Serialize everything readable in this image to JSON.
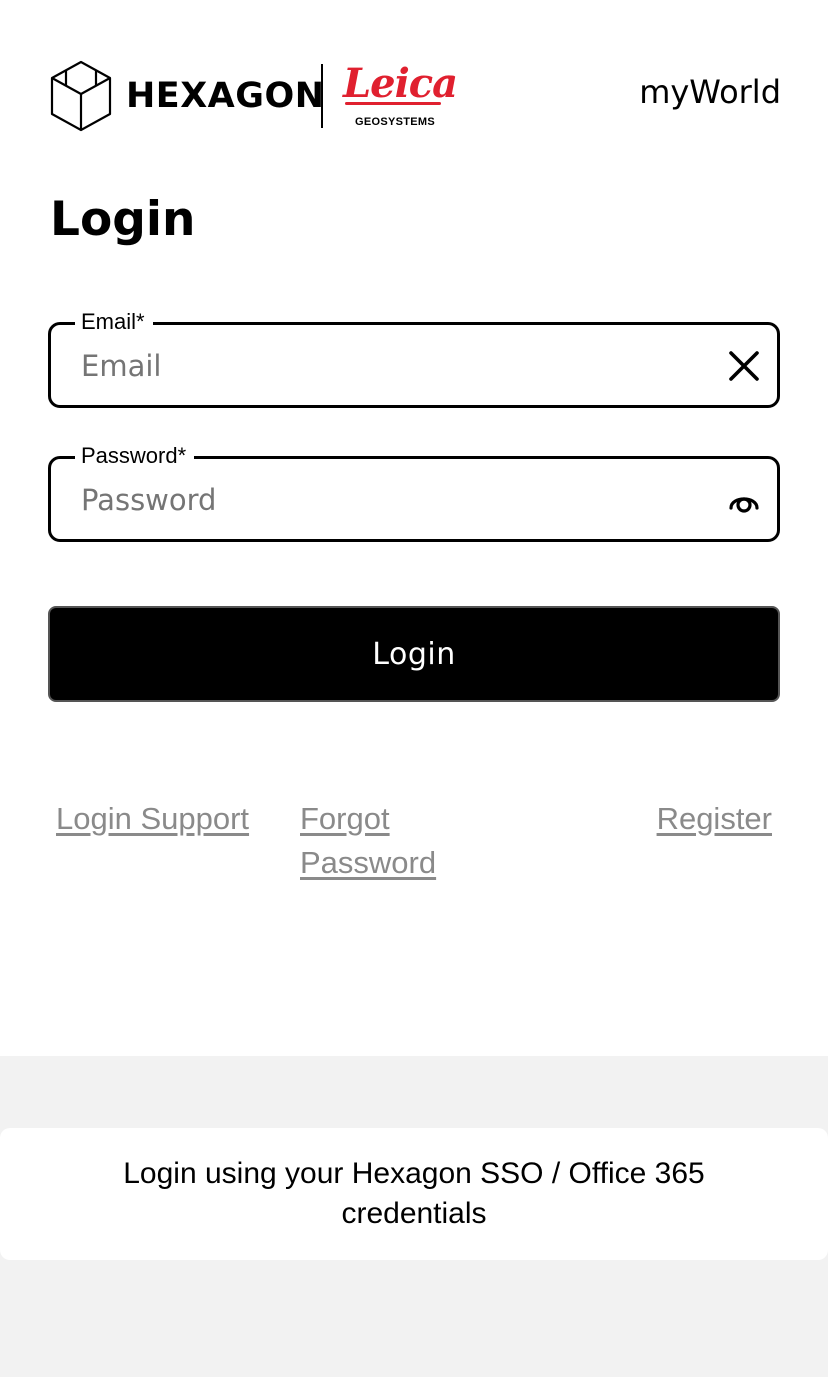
{
  "header": {
    "brand_name": "HEXAGON",
    "partner_name": "Leica",
    "partner_subtitle": "GEOSYSTEMS",
    "app_name_prefix": "my",
    "app_name_suffix": "World"
  },
  "page": {
    "title": "Login"
  },
  "form": {
    "email": {
      "label": "Email*",
      "placeholder": "Email",
      "value": "",
      "icon": "close-icon"
    },
    "password": {
      "label": "Password*",
      "placeholder": "Password",
      "value": "",
      "icon": "eye-icon"
    },
    "submit_label": "Login"
  },
  "links": {
    "login_support": "Login Support",
    "forgot_password": "Forgot Password",
    "register": "Register"
  },
  "sso": {
    "message": "Login using your Hexagon SSO / Office 365 credentials"
  },
  "colors": {
    "leica_red": "#e0202f",
    "button_bg": "#000000",
    "link_gray": "#8a8a8a",
    "footer_bg": "#f2f2f2"
  }
}
